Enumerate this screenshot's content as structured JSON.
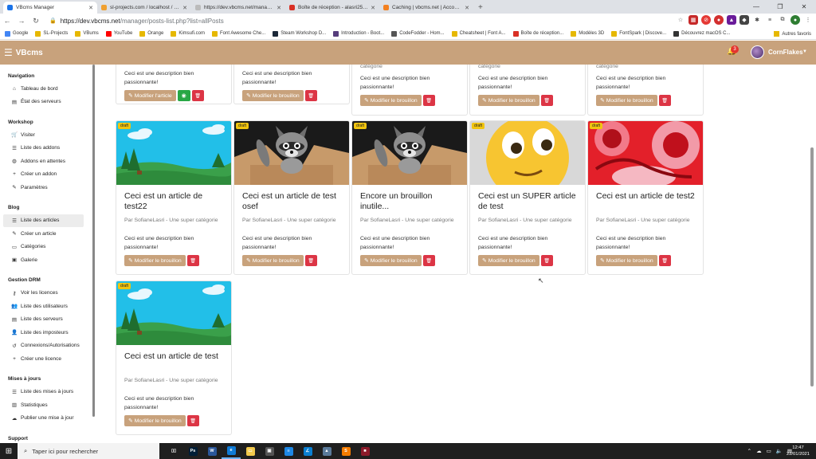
{
  "browser": {
    "tabs": [
      {
        "label": "VBcms Manager",
        "color": "#1a73e8",
        "active": true
      },
      {
        "label": "sl-projects.com / localhost / vbcms",
        "color": "#f0a030",
        "active": false
      },
      {
        "label": "https://dev.vbcms.net/manager/...",
        "color": "#bbbbbb",
        "active": false
      },
      {
        "label": "Boîte de réception - alasri2500@...",
        "color": "#d93025",
        "active": false
      },
      {
        "label": "Caching | vbcms.net | Account | C...",
        "color": "#f38020",
        "active": false
      }
    ],
    "url_host": "https://dev.vbcms.net",
    "url_path": "/manager/posts-list.php?list=allPosts",
    "bookmarks": [
      {
        "label": "Google",
        "color": "#4285f4"
      },
      {
        "label": "SL-Projects",
        "color": "#e6b800"
      },
      {
        "label": "VBums",
        "color": "#e6b800"
      },
      {
        "label": "YouTube",
        "color": "#ff0000"
      },
      {
        "label": "Orange",
        "color": "#e6b800"
      },
      {
        "label": "Kimsufi.com",
        "color": "#e6b800"
      },
      {
        "label": "Font Awesome Che...",
        "color": "#e6b800"
      },
      {
        "label": "Steam Workshop D...",
        "color": "#1b2838"
      },
      {
        "label": "Introduction - Boot...",
        "color": "#563d7c"
      },
      {
        "label": "CodeFodder - Hom...",
        "color": "#555555"
      },
      {
        "label": "Cheatsheet | Font A...",
        "color": "#e6b800"
      },
      {
        "label": "Boîte de réception...",
        "color": "#d93025"
      },
      {
        "label": "Modèles 3D",
        "color": "#e6b800"
      },
      {
        "label": "FontSpark | Discove...",
        "color": "#e6b800"
      },
      {
        "label": "Découvrez macOS C...",
        "color": "#333333"
      }
    ],
    "bookmarks_other": "Autres favoris"
  },
  "app": {
    "brand": "VBcms",
    "notif_count": "3",
    "username": "CornFlakes",
    "accent": "#c8a27c"
  },
  "sidebar": [
    {
      "section": "Navigation",
      "items": [
        {
          "label": "Tableau de bord",
          "icon": "home-icon",
          "glyph": "⌂"
        },
        {
          "label": "État des serveurs",
          "icon": "server-icon",
          "glyph": "▤"
        }
      ]
    },
    {
      "section": "Workshop",
      "items": [
        {
          "label": "Visiter",
          "icon": "cart-icon",
          "glyph": "🛒"
        },
        {
          "label": "Liste des addons",
          "icon": "list-icon",
          "glyph": "☰"
        },
        {
          "label": "Addons en attentes",
          "icon": "globe-icon",
          "glyph": "◍"
        },
        {
          "label": "Créer un addon",
          "icon": "plus-icon",
          "glyph": "+"
        },
        {
          "label": "Paramètres",
          "icon": "wrench-icon",
          "glyph": "✎"
        }
      ]
    },
    {
      "section": "Blog",
      "items": [
        {
          "label": "Liste des articles",
          "icon": "list-icon",
          "glyph": "☰",
          "active": true
        },
        {
          "label": "Créer un article",
          "icon": "pencil-icon",
          "glyph": "✎"
        },
        {
          "label": "Catégories",
          "icon": "folder-icon",
          "glyph": "▭"
        },
        {
          "label": "Galerie",
          "icon": "image-icon",
          "glyph": "▣"
        }
      ]
    },
    {
      "section": "Gestion DRM",
      "items": [
        {
          "label": "Voir les licences",
          "icon": "key-icon",
          "glyph": "⚷"
        },
        {
          "label": "Liste des utilisateurs",
          "icon": "users-icon",
          "glyph": "👥"
        },
        {
          "label": "Liste des serveurs",
          "icon": "server-icon",
          "glyph": "▤"
        },
        {
          "label": "Liste des imposteurs",
          "icon": "user-x-icon",
          "glyph": "👤"
        },
        {
          "label": "Connexions/Autorisations",
          "icon": "history-icon",
          "glyph": "↺"
        },
        {
          "label": "Créer une licence",
          "icon": "plus-icon",
          "glyph": "+"
        }
      ]
    },
    {
      "section": "Mises à jours",
      "items": [
        {
          "label": "Liste des mises à jours",
          "icon": "list-icon",
          "glyph": "☰"
        },
        {
          "label": "Statistiques",
          "icon": "chart-icon",
          "glyph": "▥"
        },
        {
          "label": "Publier une mise à jour",
          "icon": "cloud-upload-icon",
          "glyph": "☁"
        }
      ]
    },
    {
      "section": "Support",
      "items": []
    }
  ],
  "top_cards": [
    {
      "meta": "",
      "desc": "Ceci est une description bien passionnante!",
      "edit": "Modifier l'article",
      "view": true
    },
    {
      "meta": "",
      "desc": "Ceci est une description bien passionnante!",
      "edit": "Modifier le brouillon",
      "view": false
    },
    {
      "meta": "catégorie",
      "desc": "Ceci est une description bien passionnante!",
      "edit": "Modifier le brouillon",
      "view": false
    },
    {
      "meta": "catégorie",
      "desc": "Ceci est une description bien passionnante!",
      "edit": "Modifier le brouillon",
      "view": false
    },
    {
      "meta": "catégorie",
      "desc": "Ceci est une description bien passionnante!",
      "edit": "Modifier le brouillon",
      "view": false
    }
  ],
  "cards": [
    {
      "thumb": "landscape",
      "badge": "draft",
      "title": "Ceci est un article de test22",
      "meta": "Par SofianeLasri - Une super catégorie",
      "desc": "Ceci est une description bien passionnante!",
      "edit": "Modifier le brouillon"
    },
    {
      "thumb": "raccoon-box",
      "badge": "draft",
      "title": "Ceci est un article de test osef",
      "meta": "Par SofianeLasri - Une super catégorie",
      "desc": "Ceci est une description bien passionnante!",
      "edit": "Modifier le brouillon"
    },
    {
      "thumb": "raccoon-box",
      "badge": "draft",
      "title": "Encore un brouillon inutile...",
      "meta": "Par SofianeLasri - Une super catégorie",
      "desc": "Ceci est une description bien passionnante!",
      "edit": "Modifier le brouillon"
    },
    {
      "thumb": "emoji",
      "badge": "draft",
      "title": "Ceci est un SUPER article de test",
      "meta": "Par SofianeLasri - Une super catégorie",
      "desc": "Ceci est une description bien passionnante!",
      "edit": "Modifier le brouillon"
    },
    {
      "thumb": "red-art",
      "badge": "draft",
      "title": "Ceci est un article de test2",
      "meta": "Par SofianeLasri - Une super catégorie",
      "desc": "Ceci est une description bien passionnante!",
      "edit": "Modifier le brouillon"
    },
    {
      "thumb": "landscape",
      "badge": "draft",
      "title": "Ceci est un article de test",
      "meta": "Par SofianeLasri - Une super catégorie",
      "desc": "Ceci est une description bien passionnante!",
      "edit": "Modifier le brouillon"
    }
  ],
  "taskbar": {
    "search_placeholder": "Taper ici pour rechercher",
    "apps": [
      {
        "name": "task-view-icon",
        "color": "#1f1f1f",
        "glyph": "▯▯"
      },
      {
        "name": "photoshop-icon",
        "color": "#001e36",
        "glyph": "Ps"
      },
      {
        "name": "word-icon",
        "color": "#2b579a",
        "glyph": "W"
      },
      {
        "name": "edge-icon",
        "color": "#0f7bd6",
        "glyph": "e"
      },
      {
        "name": "explorer-icon",
        "color": "#f2c94c",
        "glyph": "▭"
      },
      {
        "name": "store-icon",
        "color": "#555555",
        "glyph": "▣"
      },
      {
        "name": "notepad-icon",
        "color": "#1e88e5",
        "glyph": "≡"
      },
      {
        "name": "vscode-icon",
        "color": "#0a7fd1",
        "glyph": "∠"
      },
      {
        "name": "photos-icon",
        "color": "#5a7a9a",
        "glyph": "▲"
      },
      {
        "name": "sublime-icon",
        "color": "#f57c00",
        "glyph": "S"
      },
      {
        "name": "app-red-icon",
        "color": "#8b1a2a",
        "glyph": "■"
      }
    ],
    "time": "12:47",
    "date": "22/01/2021"
  }
}
